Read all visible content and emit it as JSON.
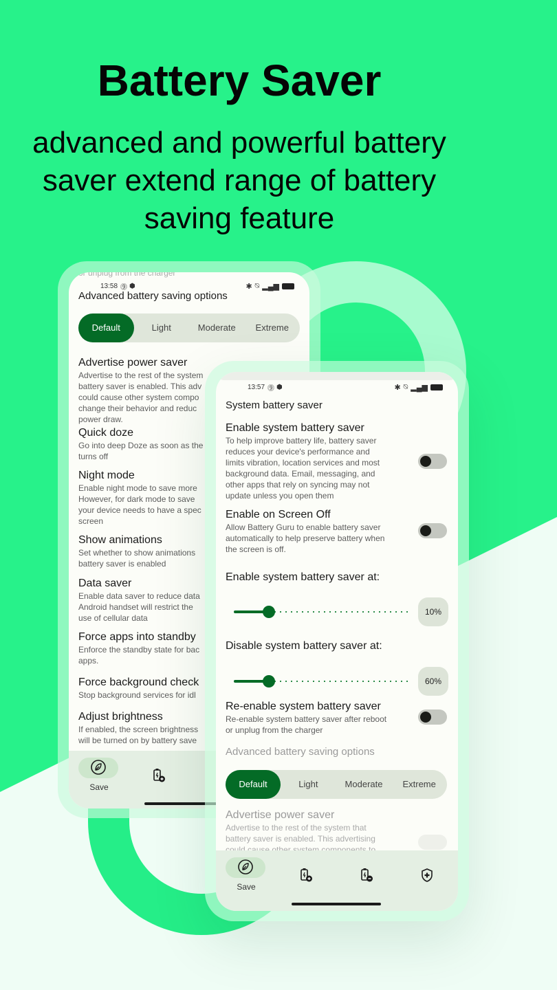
{
  "hero": {
    "title": "Battery Saver",
    "subtitle_lines": [
      "advanced and powerful battery",
      "saver extend range of battery",
      "saving feature"
    ]
  },
  "colors": {
    "accent_green": "#046b26",
    "background_green": "#27f28a",
    "ring_light": "#a8fbcf",
    "screen_bg": "#fcfdf8",
    "segment_bg": "#dfe6da",
    "nav_bg": "#e4efe3"
  },
  "phone_back": {
    "overflow_text": "or unplug from the charger",
    "status": {
      "time": "13:58",
      "icons": [
        "notification-badge-icon",
        "shield-icon",
        "bluetooth-icon",
        "muted-bell-icon",
        "signal-icon",
        "battery-icon"
      ]
    },
    "section_title": "Advanced battery saving options",
    "segments": [
      "Default",
      "Light",
      "Moderate",
      "Extreme"
    ],
    "selected_segment": "Default",
    "prefs": [
      {
        "title": "Advertise power saver",
        "desc": [
          "Advertise to the rest of the system",
          "battery saver is enabled. This adv",
          "could cause other system compo",
          "change their behavior and reduc",
          "power draw."
        ]
      },
      {
        "title": "Quick doze",
        "desc": [
          "Go into deep Doze as soon as the",
          "turns off"
        ]
      },
      {
        "title": "Night mode",
        "desc": [
          "Enable night mode to save more",
          "However, for dark mode to save",
          "your device needs to have a spec",
          "screen"
        ]
      },
      {
        "title": "Show animations",
        "desc": [
          "Set whether to show animations",
          "battery saver is enabled"
        ]
      },
      {
        "title": "Data saver",
        "desc": [
          "Enable data saver to reduce data",
          "Android handset will restrict the",
          "use of cellular data"
        ]
      },
      {
        "title": "Force apps into standby",
        "desc": [
          "Enforce the standby state for bac",
          "apps."
        ]
      },
      {
        "title": "Force background check",
        "desc": [
          "Stop background services for idl"
        ]
      },
      {
        "title": "Adjust brightness",
        "desc": [
          "If enabled, the screen brightness",
          "will be turned on by battery save"
        ]
      }
    ],
    "nav": [
      {
        "label": "Save",
        "icon": "leaf-icon",
        "active": true
      },
      {
        "label": "",
        "icon": "battery-plus-icon",
        "active": false
      }
    ]
  },
  "phone_front": {
    "status": {
      "time": "13:57",
      "icons": [
        "notification-badge-icon",
        "shield-icon",
        "bluetooth-icon",
        "muted-bell-icon",
        "signal-icon",
        "battery-icon"
      ]
    },
    "section_title": "System battery saver",
    "prefs": [
      {
        "title": "Enable system battery saver",
        "desc": [
          "To help improve battery life, battery saver",
          "reduces your device's performance and",
          "limits vibration, location services and most",
          "background data. Email, messaging, and",
          "other apps that rely on syncing may not",
          "update unless you open them"
        ],
        "toggle_on": false
      },
      {
        "title": "Enable on Screen Off",
        "desc": [
          "Allow Battery Guru to enable battery saver",
          "automatically to help preserve battery when",
          "the screen is off."
        ],
        "toggle_on": false
      }
    ],
    "sliders": [
      {
        "label": "Enable system battery saver at:",
        "value": "10%",
        "fraction": 0.2
      },
      {
        "label": "Disable system battery saver at:",
        "value": "60%",
        "fraction": 0.2
      }
    ],
    "reenable": {
      "title": "Re-enable system battery saver",
      "desc": [
        "Re-enable system battery saver after reboot",
        "or unplug from the charger"
      ],
      "toggle_on": false
    },
    "advanced_title": "Advanced battery saving options",
    "segments": [
      "Default",
      "Light",
      "Moderate",
      "Extreme"
    ],
    "selected_segment": "Default",
    "advertise": {
      "title": "Advertise power saver",
      "desc": [
        "Advertise to the rest of the system that",
        "battery saver is enabled. This advertising",
        "could cause other system components to"
      ]
    },
    "nav": [
      {
        "label": "Save",
        "icon": "leaf-icon",
        "active": true
      },
      {
        "label": "",
        "icon": "battery-plus-icon",
        "active": false
      },
      {
        "label": "",
        "icon": "battery-minus-icon",
        "active": false
      },
      {
        "label": "",
        "icon": "shield-plus-icon",
        "active": false
      }
    ]
  }
}
